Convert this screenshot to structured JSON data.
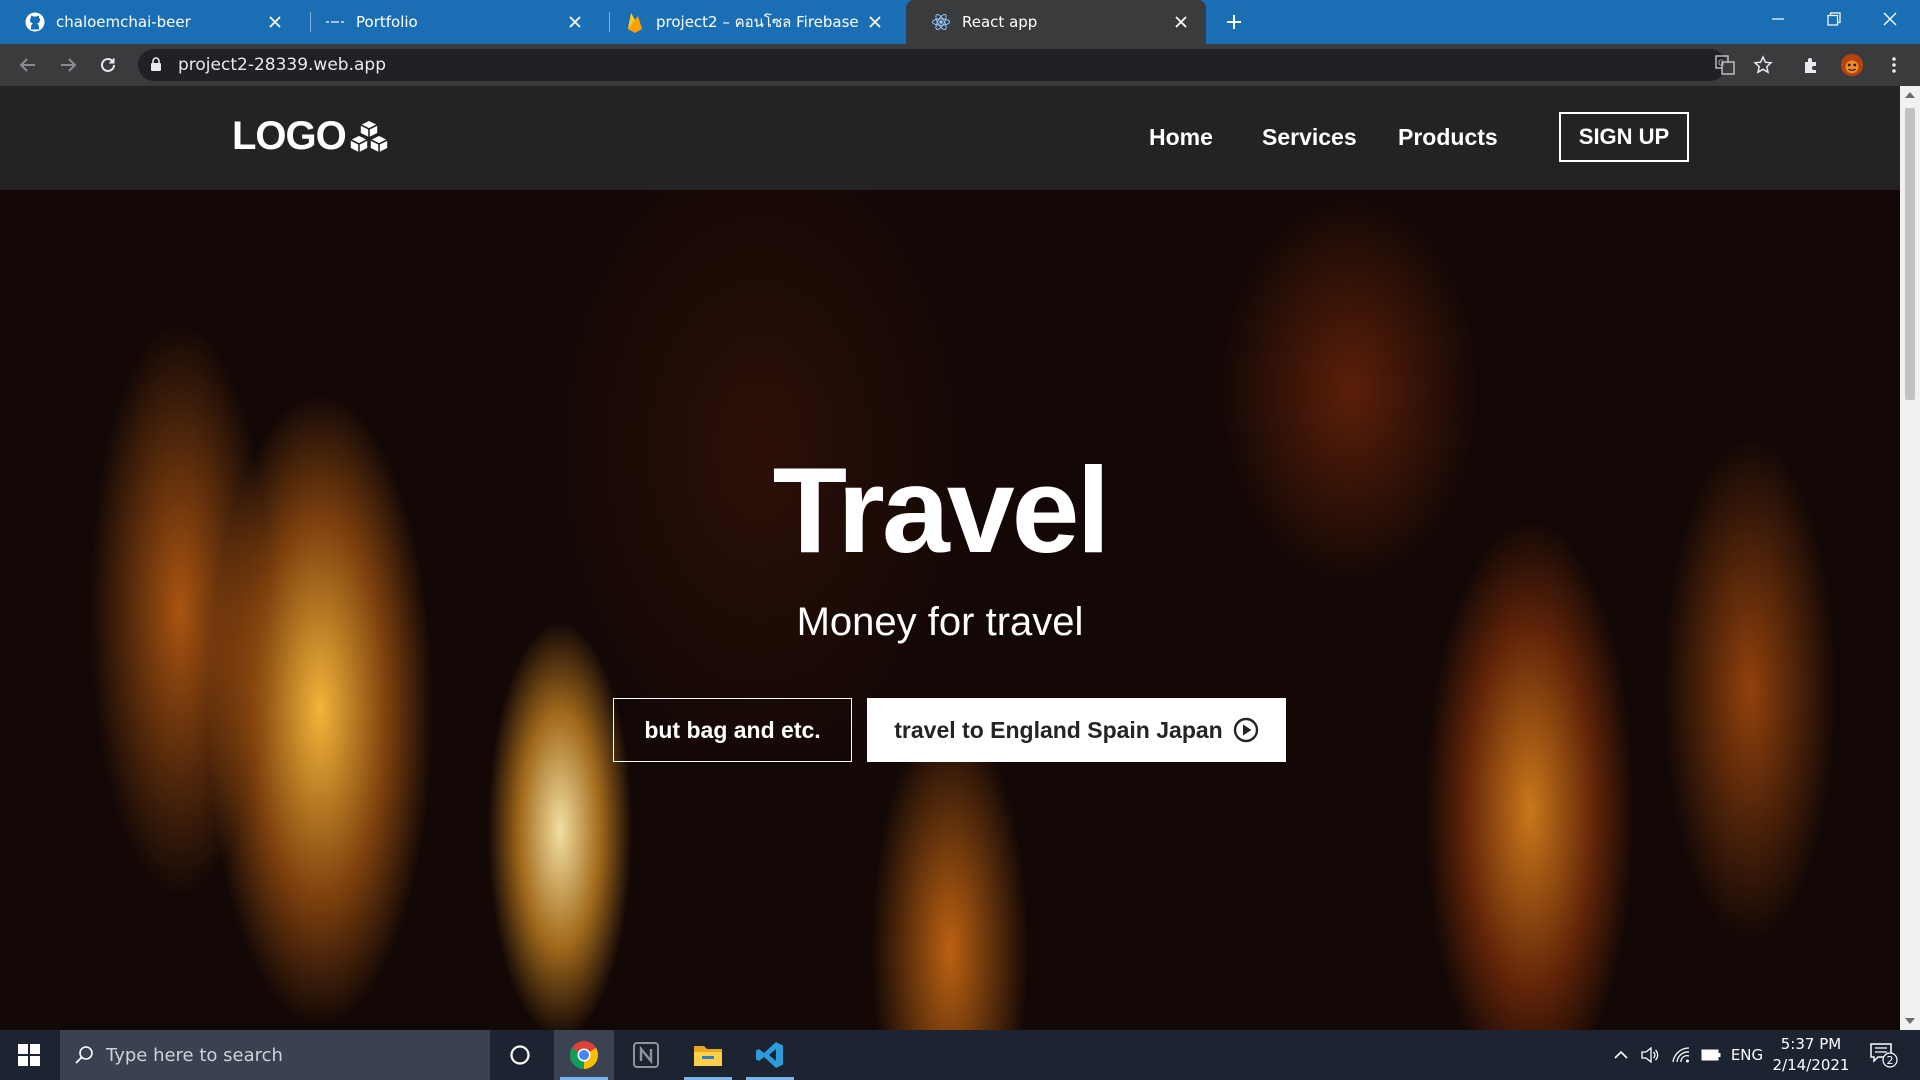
{
  "browser": {
    "tabs": [
      {
        "title": "chaloemchai-beer",
        "icon": "github-icon",
        "active": false
      },
      {
        "title": "Portfolio",
        "icon": "portfolio-icon",
        "active": false
      },
      {
        "title": "project2 – คอนโซล Firebase",
        "icon": "firebase-icon",
        "active": false
      },
      {
        "title": "React app",
        "icon": "react-icon",
        "active": true
      }
    ],
    "url": "project2-28339.web.app"
  },
  "site": {
    "logo_text": "LOGO",
    "nav": {
      "home": "Home",
      "services": "Services",
      "products": "Products",
      "signup": "SIGN UP"
    },
    "hero": {
      "title": "Travel",
      "subtitle": "Money for travel",
      "button_primary": "but bag and etc.",
      "button_secondary": "travel to England Spain Japan"
    }
  },
  "taskbar": {
    "search_placeholder": "Type here to search",
    "language": "ENG",
    "time": "5:37 PM",
    "date": "2/14/2021",
    "notification_count": "2"
  },
  "colors": {
    "tab_strip": "#1a6fb4",
    "toolbar": "#3a3b3d",
    "site_nav": "#232323",
    "taskbar": "#1c2331"
  }
}
